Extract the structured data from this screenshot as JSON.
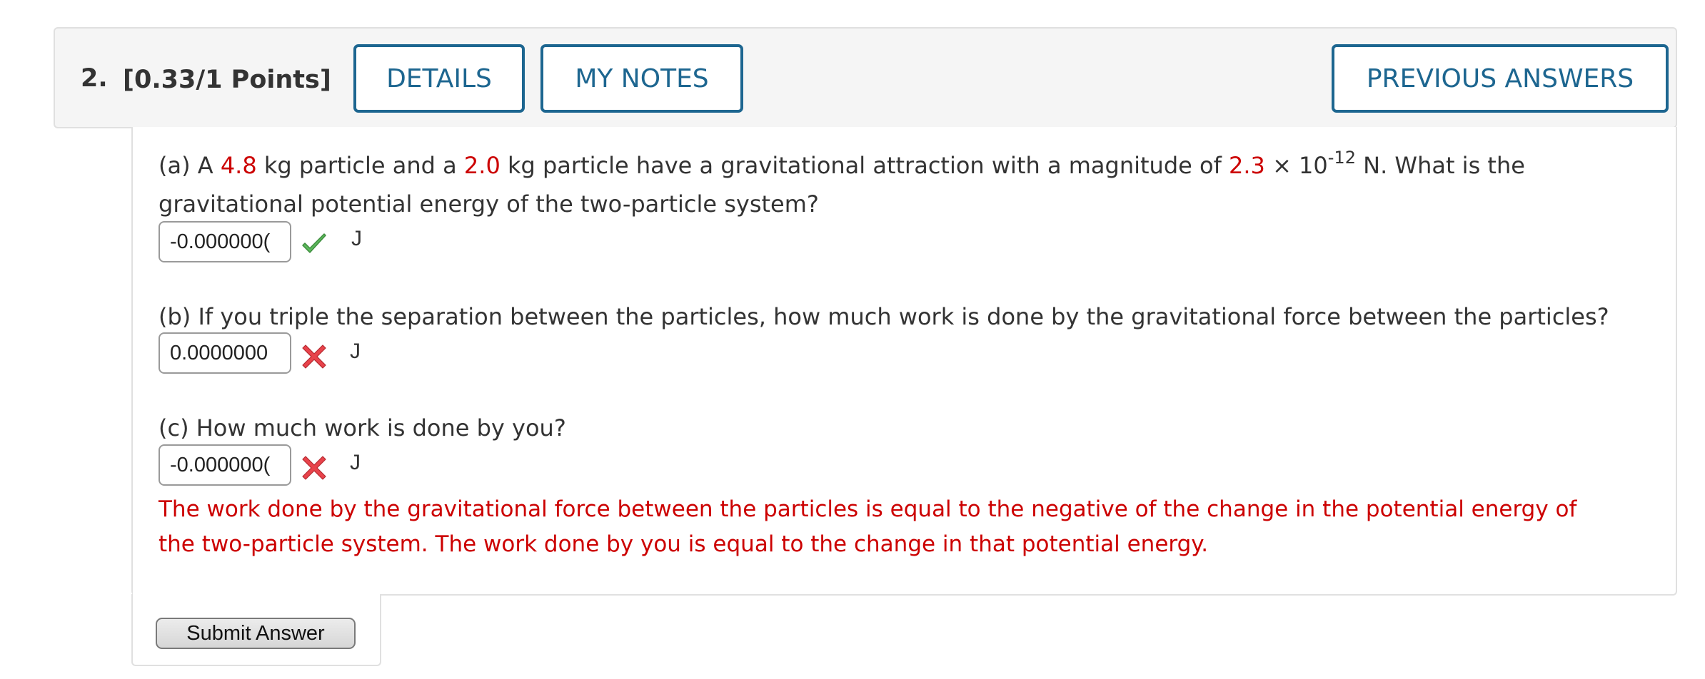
{
  "question": {
    "number": "2.",
    "points": "[0.33/1 Points]"
  },
  "header_buttons": {
    "details": "DETAILS",
    "my_notes": "MY NOTES",
    "previous_answers": "PREVIOUS ANSWERS"
  },
  "part_a": {
    "t1": "(a) A ",
    "mass1": "4.8",
    "t2": " kg particle and a ",
    "mass2": "2.0",
    "t3": " kg particle have a gravitational attraction with a magnitude of ",
    "force": "2.3",
    "t4": " × 10",
    "exponent": "-12",
    "t5": " N. What is the",
    "line2": "gravitational potential energy of the two-particle system?",
    "answer": "-0.000000(",
    "status_icon": "check-icon",
    "unit": "J"
  },
  "part_b": {
    "text": "(b) If you triple the separation between the particles, how much work is done by the gravitational force between the particles?",
    "answer": "0.0000000",
    "status_icon": "x-icon",
    "unit": "J"
  },
  "part_c": {
    "text": "(c) How much work is done by you?",
    "answer": "-0.000000(",
    "status_icon": "x-icon",
    "unit": "J"
  },
  "feedback": {
    "line1": "The work done by the gravitational force between the particles is equal to the negative of the change in the potential energy of",
    "line2": "the two-particle system. The work done by you is equal to the change in that potential energy."
  },
  "submit_label": "Submit Answer",
  "colors": {
    "accent": "#1d6690",
    "given_value": "#cc0000",
    "feedback": "#cc0000",
    "correct": "#5cb85c",
    "incorrect": "#e8434b"
  }
}
